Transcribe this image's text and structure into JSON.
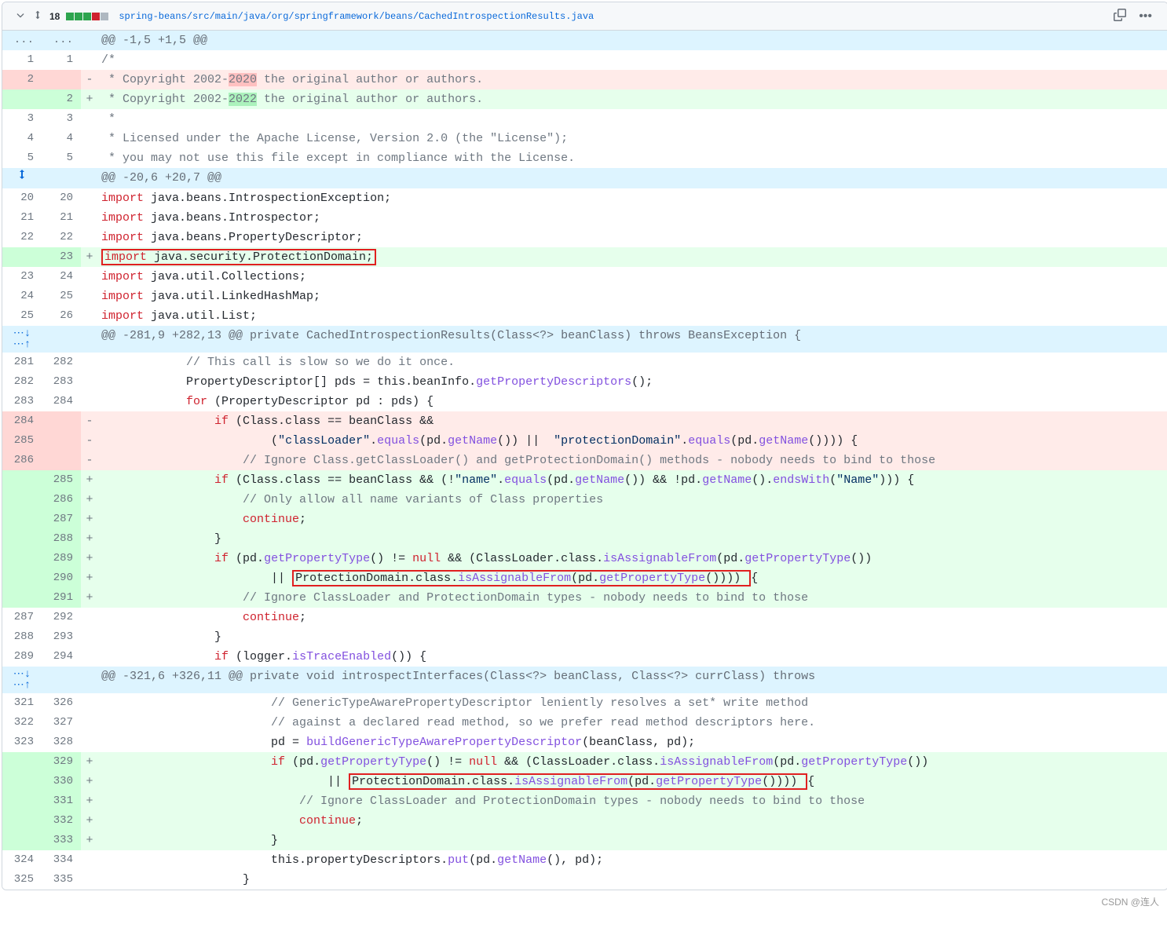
{
  "header": {
    "change_count": "18",
    "filepath": "spring-beans/src/main/java/org/springframework/beans/CachedIntrospectionResults.java"
  },
  "hunks": {
    "h1": "@@ -1,5 +1,5 @@",
    "h2": "@@ -20,6 +20,7 @@",
    "h3": "@@ -281,9 +282,13 @@ private CachedIntrospectionResults(Class<?> beanClass) throws BeansException {",
    "h4": "@@ -321,6 +326,11 @@ private void introspectInterfaces(Class<?> beanClass, Class<?> currClass) throws"
  },
  "lines": {
    "l1_old": "1",
    "l1_new": "1",
    "l2_old": "2",
    "l2b_new": "2",
    "l3_old": "3",
    "l3_new": "3",
    "l4_old": "4",
    "l4_new": "4",
    "l5_old": "5",
    "l5_new": "5",
    "l20_old": "20",
    "l20_new": "20",
    "l21_old": "21",
    "l21_new": "21",
    "l22_old": "22",
    "l22_new": "22",
    "l23n_new": "23",
    "l23_old": "23",
    "l24_new": "24",
    "l24_old": "24",
    "l25_new": "25",
    "l25_old": "25",
    "l26_new": "26",
    "l281_old": "281",
    "l282_new": "282",
    "l282_old": "282",
    "l283_new": "283",
    "l283_old": "283",
    "l284_new": "284",
    "l284_old": "284",
    "l285_old": "285",
    "l286_old": "286",
    "l285n": "285",
    "l286n": "286",
    "l287n": "287",
    "l288n": "288",
    "l289n": "289",
    "l290n": "290",
    "l291n": "291",
    "l287_old": "287",
    "l292_new": "292",
    "l288_old": "288",
    "l293_new": "293",
    "l289_old": "289",
    "l294_new": "294",
    "l321_old": "321",
    "l326_new": "326",
    "l322_old": "322",
    "l327_new": "327",
    "l323_old": "323",
    "l328_new": "328",
    "l329n": "329",
    "l330n": "330",
    "l331n": "331",
    "l332n": "332",
    "l333n": "333",
    "l324_old": "324",
    "l334_new": "334",
    "l325_old": "325",
    "l335_new": "335"
  },
  "code": {
    "c1": "/*",
    "c2_del_pre": " * Copyright 2002-",
    "c2_del_hl": "2020",
    "c2_del_post": " the original author or authors.",
    "c2_add_pre": " * Copyright 2002-",
    "c2_add_hl": "2022",
    "c2_add_post": " the original author or authors.",
    "c3": " *",
    "c4": " * Licensed under the Apache License, Version 2.0 (the \"License\");",
    "c5": " * you may not use this file except in compliance with the License.",
    "imp1_kw": "import",
    "imp1_rest": " java.beans.IntrospectionException;",
    "imp2_kw": "import",
    "imp2_rest": " java.beans.Introspector;",
    "imp3_kw": "import",
    "imp3_rest": " java.beans.PropertyDescriptor;",
    "imp4_kw": "import",
    "imp4_rest": " java.security.ProtectionDomain;",
    "imp5_kw": "import",
    "imp5_rest": " java.util.Collections;",
    "imp6_kw": "import",
    "imp6_rest": " java.util.LinkedHashMap;",
    "imp7_kw": "import",
    "imp7_rest": " java.util.List;",
    "p281": "\t\t\t// This call is slow so we do it once.",
    "p282_a": "\t\t\tPropertyDescriptor[] pds = this.beanInfo.",
    "p282_fn": "getPropertyDescriptors",
    "p282_b": "();",
    "p283_a": "\t\t\t",
    "p283_kw": "for",
    "p283_b": " (PropertyDescriptor pd : pds) {",
    "d284_a": "\t\t\t\t",
    "d284_kw": "if",
    "d284_b": " (Class.class == beanClass &&",
    "d285_a": "\t\t\t\t\t\t(",
    "d285_s1": "\"classLoader\"",
    "d285_b": ".",
    "d285_fn1": "equals",
    "d285_c": "(pd.",
    "d285_fn2": "getName",
    "d285_d": "()) ||  ",
    "d285_s2": "\"protectionDomain\"",
    "d285_e": ".",
    "d285_fn3": "equals",
    "d285_f": "(pd.",
    "d285_fn4": "getName",
    "d285_g": "()))) {",
    "d286": "\t\t\t\t\t// Ignore Class.getClassLoader() and getProtectionDomain() methods - nobody needs to bind to those",
    "a285_a": "\t\t\t\t",
    "a285_kw": "if",
    "a285_b": " (Class.class == beanClass && (!",
    "a285_s1": "\"name\"",
    "a285_c": ".",
    "a285_fn1": "equals",
    "a285_d": "(pd.",
    "a285_fn2": "getName",
    "a285_e": "()) && !pd.",
    "a285_fn3": "getName",
    "a285_f": "().",
    "a285_fn4": "endsWith",
    "a285_g": "(",
    "a285_s2": "\"Name\"",
    "a285_h": "))) {",
    "a286": "\t\t\t\t\t// Only allow all name variants of Class properties",
    "a287_a": "\t\t\t\t\t",
    "a287_kw": "continue",
    "a287_b": ";",
    "a288": "\t\t\t\t}",
    "a289_a": "\t\t\t\t",
    "a289_kw": "if",
    "a289_b": " (pd.",
    "a289_fn1": "getPropertyType",
    "a289_c": "() != ",
    "a289_null": "null",
    "a289_d": " && (ClassLoader.class.",
    "a289_fn2": "isAssignableFrom",
    "a289_e": "(pd.",
    "a289_fn3": "getPropertyType",
    "a289_f": "())",
    "a290_a": "\t\t\t\t\t\t|| ",
    "a290_box": "ProtectionDomain.class.",
    "a290_fn": "isAssignableFrom",
    "a290_b": "(pd.",
    "a290_fn2": "getPropertyType",
    "a290_c": "()))) ",
    "a290_d": "{",
    "a291": "\t\t\t\t\t// Ignore ClassLoader and ProtectionDomain types - nobody needs to bind to those",
    "p287_a": "\t\t\t\t\t",
    "p287_kw": "continue",
    "p287_b": ";",
    "p288": "\t\t\t\t}",
    "p289_a": "\t\t\t\t",
    "p289_kw": "if",
    "p289_b": " (logger.",
    "p289_fn": "isTraceEnabled",
    "p289_c": "()) {",
    "p321": "\t\t\t\t\t\t// GenericTypeAwarePropertyDescriptor leniently resolves a set* write method",
    "p322": "\t\t\t\t\t\t// against a declared read method, so we prefer read method descriptors here.",
    "p323_a": "\t\t\t\t\t\tpd = ",
    "p323_fn": "buildGenericTypeAwarePropertyDescriptor",
    "p323_b": "(beanClass, pd);",
    "a329_a": "\t\t\t\t\t\t",
    "a329_kw": "if",
    "a329_b": " (pd.",
    "a329_fn1": "getPropertyType",
    "a329_c": "() != ",
    "a329_null": "null",
    "a329_d": " && (ClassLoader.class.",
    "a329_fn2": "isAssignableFrom",
    "a329_e": "(pd.",
    "a329_fn3": "getPropertyType",
    "a329_f": "())",
    "a330_a": "\t\t\t\t\t\t\t\t|| ",
    "a330_box": "ProtectionDomain.class.",
    "a330_fn": "isAssignableFrom",
    "a330_b": "(pd.",
    "a330_fn2": "getPropertyType",
    "a330_c": "()))) ",
    "a330_d": "{",
    "a331": "\t\t\t\t\t\t\t// Ignore ClassLoader and ProtectionDomain types - nobody needs to bind to those",
    "a332_a": "\t\t\t\t\t\t\t",
    "a332_kw": "continue",
    "a332_b": ";",
    "a333": "\t\t\t\t\t\t}",
    "p324_a": "\t\t\t\t\t\tthis.propertyDescriptors.",
    "p324_fn": "put",
    "p324_b": "(pd.",
    "p324_fn2": "getName",
    "p324_c": "(), pd);",
    "p325": "\t\t\t\t\t}"
  },
  "watermark": "CSDN @连人"
}
